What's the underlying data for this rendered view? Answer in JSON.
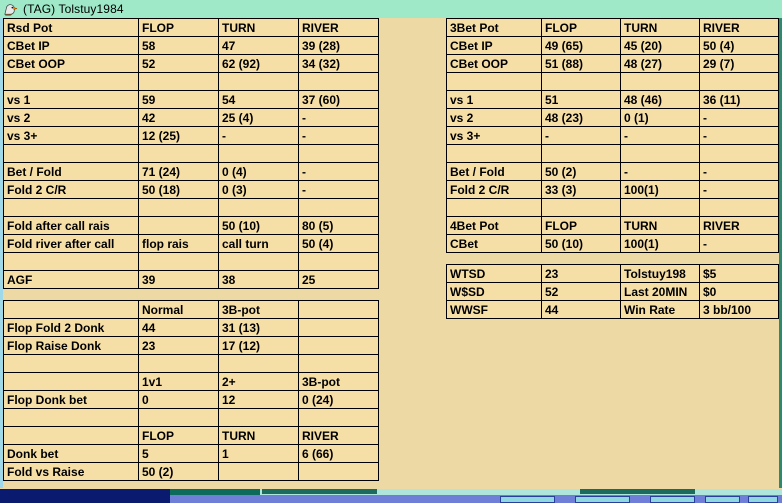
{
  "window": {
    "icon": "eagle-head-icon",
    "title": "(TAG) Tolstuy1984",
    "titlebar_color": "#9fe8c8"
  },
  "colors": {
    "header_title": "#9ff0d0",
    "header_street": "#7cc3cc",
    "label_green": "#86d68c",
    "label_orange": "#ef8142",
    "label_red": "#d4717a",
    "cell_bg": "#f6dfa6",
    "page_bg": "#edd9a3",
    "text_blue": "#0018d8",
    "text_green": "#1f8a3c"
  },
  "left_panel": {
    "table_rsd": {
      "header": {
        "title": "Rsd Pot",
        "flop": "FLOP",
        "turn": "TURN",
        "river": "RIVER"
      },
      "rows": [
        {
          "label": "CBet IP",
          "flop": "58",
          "turn": "47",
          "river": "39 (28)"
        },
        {
          "label": "CBet OOP",
          "flop": "52",
          "turn": "62 (92)",
          "river": "34 (32)"
        },
        {
          "label": "",
          "flop": "",
          "turn": "",
          "river": ""
        },
        {
          "label": "vs 1",
          "flop": "59",
          "turn": "54",
          "river": "37 (60)"
        },
        {
          "label": "vs 2",
          "flop": "42",
          "turn": "25 (4)",
          "river": "-"
        },
        {
          "label": "vs 3+",
          "flop": "12 (25)",
          "turn": "-",
          "river": "-"
        },
        {
          "label": "",
          "flop": "",
          "turn": "",
          "river": ""
        },
        {
          "label": "Bet / Fold",
          "flop": "71 (24)",
          "turn": "0 (4)",
          "river": "-"
        },
        {
          "label": "Fold 2 C/R",
          "flop": "50 (18)",
          "turn": "0 (3)",
          "river": "-"
        },
        {
          "label": "",
          "flop": "",
          "turn": "",
          "river": ""
        },
        {
          "label": "Fold after call rais",
          "flop": "",
          "turn": "50 (10)",
          "river": "80 (5)"
        },
        {
          "label": "Fold river after call",
          "flop": "flop rais",
          "turn": "call turn",
          "river": "50 (4)"
        },
        {
          "label": "",
          "flop": "",
          "turn": "",
          "river": ""
        },
        {
          "label": "AGF",
          "flop": "39",
          "turn": "38",
          "river": "25"
        }
      ]
    },
    "table_donk": {
      "rows": [
        {
          "label": "",
          "c1": "Normal",
          "c2": "3B-pot",
          "c3": ""
        },
        {
          "label": "Flop Fold 2 Donk",
          "c1": "44",
          "c2": "31 (13)",
          "c3": ""
        },
        {
          "label": "Flop Raise Donk",
          "c1": "23",
          "c2": "17 (12)",
          "c3": ""
        },
        {
          "label": "",
          "c1": "",
          "c2": "",
          "c3": ""
        },
        {
          "label": "",
          "c1": "1v1",
          "c2": "2+",
          "c3": "3B-pot"
        },
        {
          "label": "Flop Donk bet",
          "c1": "0",
          "c2": "12",
          "c3": "0 (24)"
        }
      ]
    },
    "table_donkbet": {
      "rows": [
        {
          "label": "",
          "c1": "FLOP",
          "c2": "TURN",
          "c3": "RIVER"
        },
        {
          "label": "Donk bet",
          "c1": "5",
          "c2": "1",
          "c3": "6 (66)"
        },
        {
          "label": "Fold vs Raise",
          "c1": "50 (2)",
          "c2": "",
          "c3": ""
        }
      ]
    }
  },
  "right_panel": {
    "table_3bet": {
      "header": {
        "title": "3Bet  Pot",
        "flop": "FLOP",
        "turn": "TURN",
        "river": "RIVER"
      },
      "rows": [
        {
          "label": "CBet IP",
          "flop": "49 (65)",
          "turn": "45 (20)",
          "river": "50 (4)"
        },
        {
          "label": "CBet OOP",
          "flop": "51 (88)",
          "turn": "48 (27)",
          "river": "29 (7)"
        },
        {
          "label": "",
          "flop": "",
          "turn": "",
          "river": ""
        },
        {
          "label": "vs 1",
          "flop": "51",
          "turn": "48 (46)",
          "river": "36 (11)"
        },
        {
          "label": "vs 2",
          "flop": "48 (23)",
          "turn": "0 (1)",
          "river": "-"
        },
        {
          "label": "vs 3+",
          "flop": "-",
          "turn": "-",
          "river": "-"
        },
        {
          "label": "",
          "flop": "",
          "turn": "",
          "river": ""
        },
        {
          "label": "Bet / Fold",
          "flop": "50 (2)",
          "turn": "-",
          "river": "-"
        },
        {
          "label": "Fold 2 C/R",
          "flop": "33 (3)",
          "turn": "100(1)",
          "river": "-"
        },
        {
          "label": "",
          "flop": "",
          "turn": "",
          "river": ""
        }
      ]
    },
    "table_4bet": {
      "header": {
        "title": "4Bet Pot",
        "flop": "FLOP",
        "turn": "TURN",
        "river": "RIVER"
      },
      "rows": [
        {
          "label": "CBet",
          "flop": "50 (10)",
          "turn": "100(1)",
          "river": "-"
        }
      ]
    },
    "table_showdown": {
      "rows": [
        {
          "label": "WTSD",
          "value": "23",
          "stat": "Tolstuy198",
          "amount": "$5"
        },
        {
          "label": "W$SD",
          "value": "52",
          "stat": "Last 20MIN",
          "amount": "$0"
        },
        {
          "label": "WWSF",
          "value": "44",
          "stat": "Win Rate",
          "amount": "3 bb/100"
        }
      ]
    }
  }
}
